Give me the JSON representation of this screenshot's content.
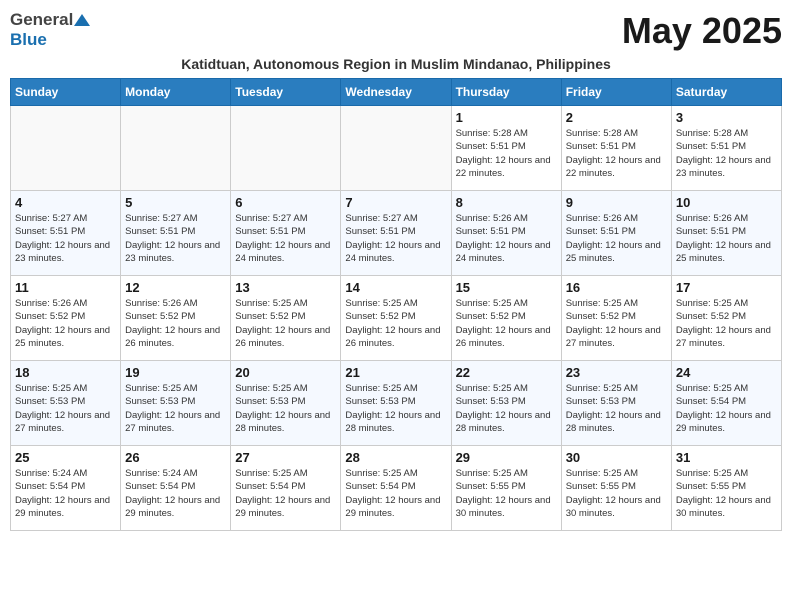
{
  "header": {
    "logo_general": "General",
    "logo_blue": "Blue",
    "month_title": "May 2025",
    "subtitle": "Katidtuan, Autonomous Region in Muslim Mindanao, Philippines"
  },
  "weekdays": [
    "Sunday",
    "Monday",
    "Tuesday",
    "Wednesday",
    "Thursday",
    "Friday",
    "Saturday"
  ],
  "weeks": [
    [
      {
        "day": "",
        "info": ""
      },
      {
        "day": "",
        "info": ""
      },
      {
        "day": "",
        "info": ""
      },
      {
        "day": "",
        "info": ""
      },
      {
        "day": "1",
        "info": "Sunrise: 5:28 AM\nSunset: 5:51 PM\nDaylight: 12 hours\nand 22 minutes."
      },
      {
        "day": "2",
        "info": "Sunrise: 5:28 AM\nSunset: 5:51 PM\nDaylight: 12 hours\nand 22 minutes."
      },
      {
        "day": "3",
        "info": "Sunrise: 5:28 AM\nSunset: 5:51 PM\nDaylight: 12 hours\nand 23 minutes."
      }
    ],
    [
      {
        "day": "4",
        "info": "Sunrise: 5:27 AM\nSunset: 5:51 PM\nDaylight: 12 hours\nand 23 minutes."
      },
      {
        "day": "5",
        "info": "Sunrise: 5:27 AM\nSunset: 5:51 PM\nDaylight: 12 hours\nand 23 minutes."
      },
      {
        "day": "6",
        "info": "Sunrise: 5:27 AM\nSunset: 5:51 PM\nDaylight: 12 hours\nand 24 minutes."
      },
      {
        "day": "7",
        "info": "Sunrise: 5:27 AM\nSunset: 5:51 PM\nDaylight: 12 hours\nand 24 minutes."
      },
      {
        "day": "8",
        "info": "Sunrise: 5:26 AM\nSunset: 5:51 PM\nDaylight: 12 hours\nand 24 minutes."
      },
      {
        "day": "9",
        "info": "Sunrise: 5:26 AM\nSunset: 5:51 PM\nDaylight: 12 hours\nand 25 minutes."
      },
      {
        "day": "10",
        "info": "Sunrise: 5:26 AM\nSunset: 5:51 PM\nDaylight: 12 hours\nand 25 minutes."
      }
    ],
    [
      {
        "day": "11",
        "info": "Sunrise: 5:26 AM\nSunset: 5:52 PM\nDaylight: 12 hours\nand 25 minutes."
      },
      {
        "day": "12",
        "info": "Sunrise: 5:26 AM\nSunset: 5:52 PM\nDaylight: 12 hours\nand 26 minutes."
      },
      {
        "day": "13",
        "info": "Sunrise: 5:25 AM\nSunset: 5:52 PM\nDaylight: 12 hours\nand 26 minutes."
      },
      {
        "day": "14",
        "info": "Sunrise: 5:25 AM\nSunset: 5:52 PM\nDaylight: 12 hours\nand 26 minutes."
      },
      {
        "day": "15",
        "info": "Sunrise: 5:25 AM\nSunset: 5:52 PM\nDaylight: 12 hours\nand 26 minutes."
      },
      {
        "day": "16",
        "info": "Sunrise: 5:25 AM\nSunset: 5:52 PM\nDaylight: 12 hours\nand 27 minutes."
      },
      {
        "day": "17",
        "info": "Sunrise: 5:25 AM\nSunset: 5:52 PM\nDaylight: 12 hours\nand 27 minutes."
      }
    ],
    [
      {
        "day": "18",
        "info": "Sunrise: 5:25 AM\nSunset: 5:53 PM\nDaylight: 12 hours\nand 27 minutes."
      },
      {
        "day": "19",
        "info": "Sunrise: 5:25 AM\nSunset: 5:53 PM\nDaylight: 12 hours\nand 27 minutes."
      },
      {
        "day": "20",
        "info": "Sunrise: 5:25 AM\nSunset: 5:53 PM\nDaylight: 12 hours\nand 28 minutes."
      },
      {
        "day": "21",
        "info": "Sunrise: 5:25 AM\nSunset: 5:53 PM\nDaylight: 12 hours\nand 28 minutes."
      },
      {
        "day": "22",
        "info": "Sunrise: 5:25 AM\nSunset: 5:53 PM\nDaylight: 12 hours\nand 28 minutes."
      },
      {
        "day": "23",
        "info": "Sunrise: 5:25 AM\nSunset: 5:53 PM\nDaylight: 12 hours\nand 28 minutes."
      },
      {
        "day": "24",
        "info": "Sunrise: 5:25 AM\nSunset: 5:54 PM\nDaylight: 12 hours\nand 29 minutes."
      }
    ],
    [
      {
        "day": "25",
        "info": "Sunrise: 5:24 AM\nSunset: 5:54 PM\nDaylight: 12 hours\nand 29 minutes."
      },
      {
        "day": "26",
        "info": "Sunrise: 5:24 AM\nSunset: 5:54 PM\nDaylight: 12 hours\nand 29 minutes."
      },
      {
        "day": "27",
        "info": "Sunrise: 5:25 AM\nSunset: 5:54 PM\nDaylight: 12 hours\nand 29 minutes."
      },
      {
        "day": "28",
        "info": "Sunrise: 5:25 AM\nSunset: 5:54 PM\nDaylight: 12 hours\nand 29 minutes."
      },
      {
        "day": "29",
        "info": "Sunrise: 5:25 AM\nSunset: 5:55 PM\nDaylight: 12 hours\nand 30 minutes."
      },
      {
        "day": "30",
        "info": "Sunrise: 5:25 AM\nSunset: 5:55 PM\nDaylight: 12 hours\nand 30 minutes."
      },
      {
        "day": "31",
        "info": "Sunrise: 5:25 AM\nSunset: 5:55 PM\nDaylight: 12 hours\nand 30 minutes."
      }
    ]
  ]
}
